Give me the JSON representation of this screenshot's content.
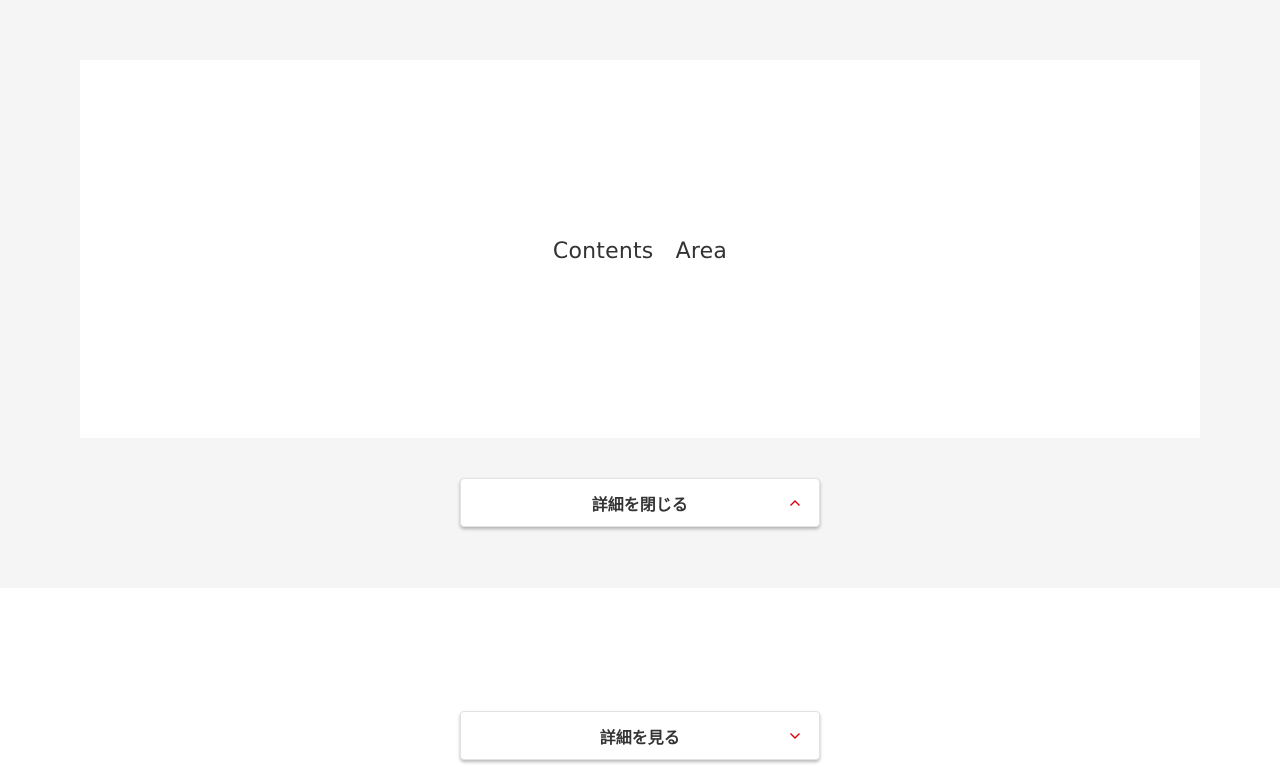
{
  "contents_area": {
    "text": "Contents　Area"
  },
  "buttons": {
    "close_details": {
      "label": "詳細を閉じる",
      "icon": "chevron-up-icon"
    },
    "show_details": {
      "label": "詳細を見る",
      "icon": "chevron-down-icon"
    }
  },
  "colors": {
    "accent": "#d7000f",
    "section_background": "#f5f5f5",
    "content_background": "#ffffff",
    "text": "#333333"
  }
}
